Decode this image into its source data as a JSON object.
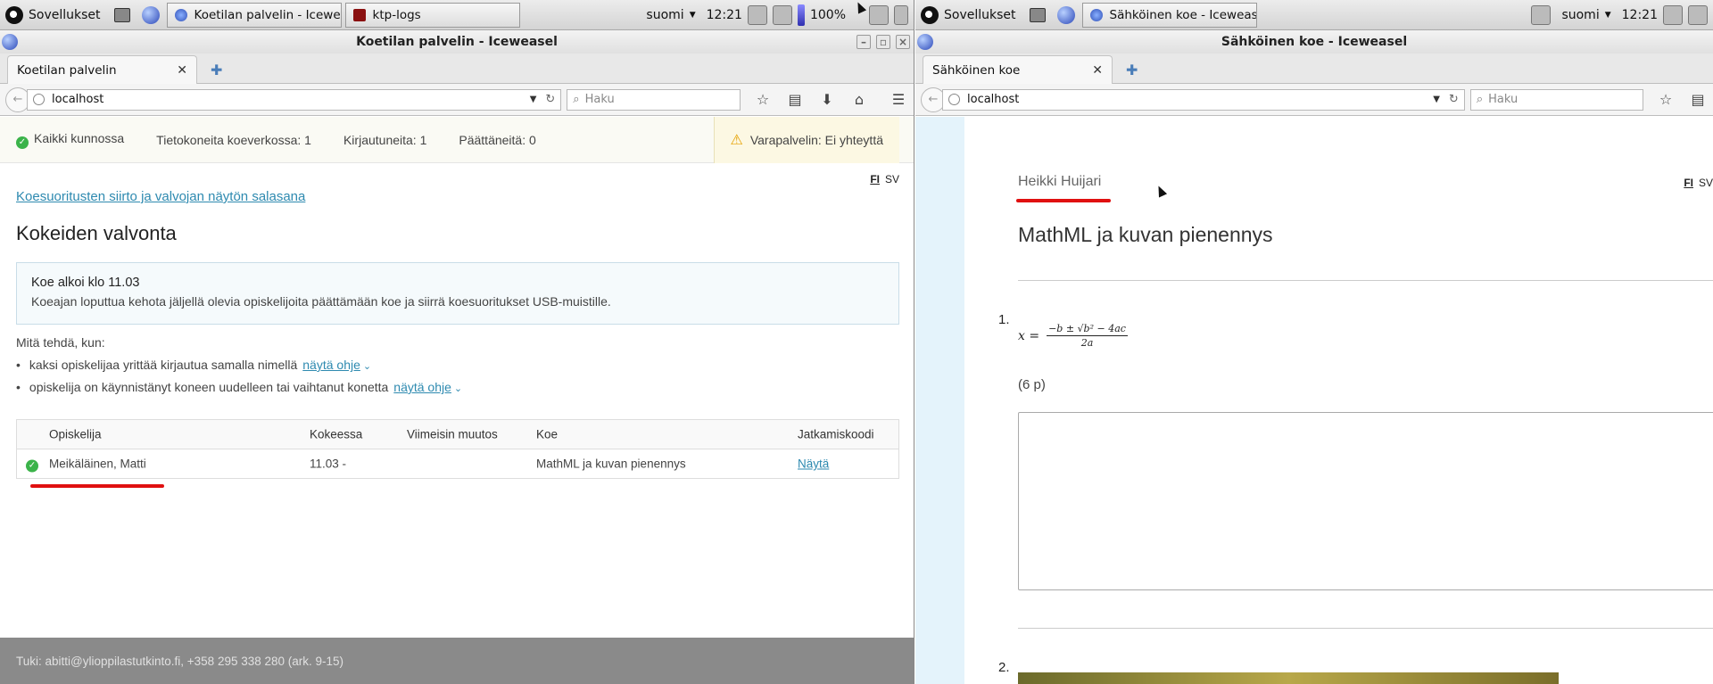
{
  "left": {
    "taskbar": {
      "apps_label": "Sovellukset",
      "tasks": [
        "Koetilan palvelin - Iceweasel",
        "ktp-logs"
      ],
      "keyboard": "suomi",
      "time": "12:21",
      "battery": "100%"
    },
    "window_title": "Koetilan palvelin - Iceweasel",
    "tab_label": "Koetilan palvelin",
    "url": "localhost",
    "search_placeholder": "Haku",
    "status": {
      "ok": "Kaikki kunnossa",
      "computers": "Tietokoneita koeverkossa: 1",
      "logged_in": "Kirjautuneita: 1",
      "finished": "Päättäneitä: 0",
      "backup": "Varapalvelin: Ei yhteyttä"
    },
    "lang": {
      "fi": "FI",
      "sv": "SV"
    },
    "password_link": "Koesuoritusten siirto ja valvojan näytön salasana",
    "heading": "Kokeiden valvonta",
    "info": {
      "title": "Koe alkoi klo 11.03",
      "text": "Koeajan loputtua kehota jäljellä olevia opiskelijoita päättämään koe ja siirrä koesuoritukset USB-muistille."
    },
    "what_to_do": "Mitä tehdä, kun:",
    "bullets": [
      {
        "text": "kaksi opiskelijaa yrittää kirjautua samalla nimellä",
        "link": "näytä ohje"
      },
      {
        "text": "opiskelija on käynnistänyt koneen uudelleen tai vaihtanut konetta",
        "link": "näytä ohje"
      }
    ],
    "table": {
      "headers": [
        "Opiskelija",
        "Kokeessa",
        "Viimeisin muutos",
        "Koe",
        "Jatkamiskoodi"
      ],
      "rows": [
        {
          "student": "Meikäläinen, Matti",
          "in_exam": "11.03 -",
          "last_change": "",
          "exam": "MathML ja kuvan pienennys",
          "code": "Näytä"
        }
      ]
    },
    "footer": "Tuki: abitti@ylioppilastutkinto.fi, +358 295 338 280 (ark. 9-15)"
  },
  "right": {
    "taskbar": {
      "apps_label": "Sovellukset",
      "tasks": [
        "Sähköinen koe - Iceweasel"
      ],
      "keyboard": "suomi",
      "time": "12:21"
    },
    "window_title": "Sähköinen koe - Iceweasel",
    "tab_label": "Sähköinen koe",
    "url": "localhost",
    "search_placeholder": "Haku",
    "lang": {
      "fi": "FI",
      "sv": "SV"
    },
    "student_name": "Heikki Huijari",
    "exam_title": "MathML ja kuvan pienennys",
    "q1_number": "1.",
    "formula": {
      "lhs": "x =",
      "numerator": "−b ± √b² − 4ac",
      "denominator": "2a"
    },
    "points": "(6 p)",
    "q2_number": "2."
  },
  "colors": {
    "link": "#2e8ab0",
    "ok": "#3bb34a",
    "warning": "#e5a100",
    "highlight": "#e01010",
    "footer": "#8a8a8a",
    "sidebar": "#e4f3fb"
  }
}
